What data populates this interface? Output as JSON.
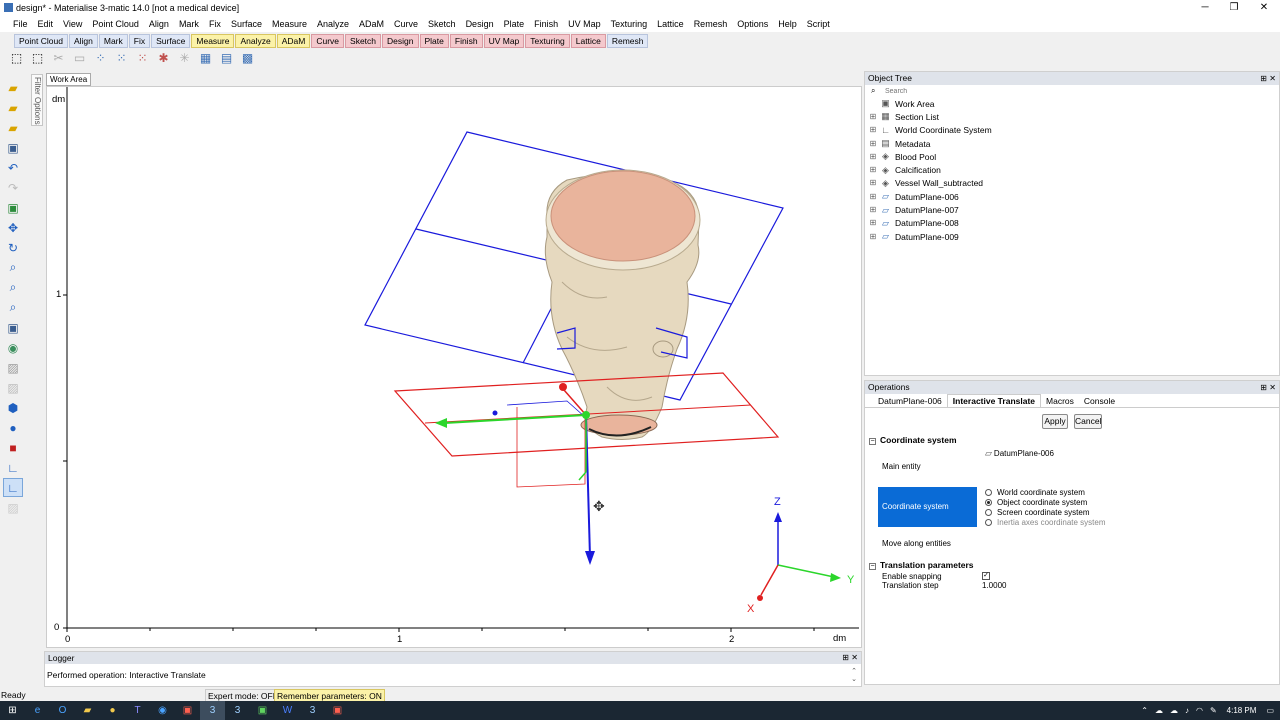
{
  "window": {
    "title": "design* - Materialise 3-matic 14.0 [not a medical device]",
    "minimize": "─",
    "maximize": "❐",
    "close": "✕"
  },
  "menu": [
    "File",
    "Edit",
    "View",
    "Point Cloud",
    "Align",
    "Mark",
    "Fix",
    "Surface",
    "Measure",
    "Analyze",
    "ADaM",
    "Curve",
    "Sketch",
    "Design",
    "Plate",
    "Finish",
    "UV Map",
    "Texturing",
    "Lattice",
    "Remesh",
    "Options",
    "Help",
    "Script"
  ],
  "mode_tabs": [
    {
      "label": "Point Cloud",
      "tone": "b"
    },
    {
      "label": "Align",
      "tone": "b"
    },
    {
      "label": "Mark",
      "tone": "b"
    },
    {
      "label": "Fix",
      "tone": "b"
    },
    {
      "label": "Surface",
      "tone": "b"
    },
    {
      "label": "Measure",
      "tone": "y"
    },
    {
      "label": "Analyze",
      "tone": "y"
    },
    {
      "label": "ADaM",
      "tone": "y"
    },
    {
      "label": "Curve",
      "tone": "p"
    },
    {
      "label": "Sketch",
      "tone": "p"
    },
    {
      "label": "Design",
      "tone": "p"
    },
    {
      "label": "Plate",
      "tone": "p"
    },
    {
      "label": "Finish",
      "tone": "p"
    },
    {
      "label": "UV Map",
      "tone": "p"
    },
    {
      "label": "Texturing",
      "tone": "p"
    },
    {
      "label": "Lattice",
      "tone": "p"
    },
    {
      "label": "Remesh",
      "tone": "b"
    }
  ],
  "toolbar_icons": [
    "select-icon",
    "deselect-icon",
    "cut-icon",
    "paste-icon",
    "mark-points-icon",
    "mark-region-icon",
    "mark-triangle-icon",
    "mark-shell-icon",
    "mark-plane-icon",
    "mark-box-icon",
    "mark-layer-icon",
    "grid-icon"
  ],
  "side_toolbar_icons": [
    "open-icon",
    "import-icon",
    "folder-icon",
    "save-icon",
    "undo-icon",
    "redo-icon",
    "view-icon",
    "pan-icon",
    "rotate-icon",
    "zoom-icon",
    "zoom-fit-icon",
    "zoom-box-icon",
    "clip-icon",
    "shade-icon",
    "wire-icon",
    "section-icon",
    "cube-icon",
    "sphere-icon",
    "render-icon",
    "axis-icon",
    "measure-icon",
    "hatch-icon"
  ],
  "filter_options": "Filter Options",
  "work_area": {
    "tab": "Work Area",
    "unit_y": "dm",
    "unit_x": "dm",
    "y_ticks": [
      "1",
      "0"
    ],
    "x_ticks": [
      "0",
      "1",
      "2"
    ],
    "axes_labels": {
      "z": "Z",
      "y": "Y",
      "x": "X"
    },
    "colors": {
      "plane_blue": "#1a1adc",
      "plane_red": "#e02020",
      "axis_green": "#2bd62b",
      "model_skin": "#e6d9bf",
      "model_top": "#e9b49c"
    }
  },
  "object_tree": {
    "title": "Object Tree",
    "search_placeholder": "Search",
    "items": [
      {
        "label": "Work Area",
        "icon": "work-area-icon",
        "indent": 0
      },
      {
        "label": "Section List",
        "icon": "section-list-icon",
        "indent": 1
      },
      {
        "label": "World Coordinate System",
        "icon": "coordinate-system-icon",
        "indent": 1
      },
      {
        "label": "Metadata",
        "icon": "metadata-icon",
        "indent": 1
      },
      {
        "label": "Blood Pool",
        "icon": "part-icon",
        "indent": 1
      },
      {
        "label": "Calcification",
        "icon": "part-icon",
        "indent": 1
      },
      {
        "label": "Vessel Wall_subtracted",
        "icon": "part-icon",
        "indent": 1
      },
      {
        "label": "DatumPlane-006",
        "icon": "datum-plane-icon",
        "indent": 1
      },
      {
        "label": "DatumPlane-007",
        "icon": "datum-plane-icon",
        "indent": 1
      },
      {
        "label": "DatumPlane-008",
        "icon": "datum-plane-icon",
        "indent": 1
      },
      {
        "label": "DatumPlane-009",
        "icon": "datum-plane-icon",
        "indent": 1
      }
    ]
  },
  "operations": {
    "title": "Operations",
    "tabs": [
      "DatumPlane-006",
      "Interactive Translate",
      "Macros",
      "Console"
    ],
    "active_tab": "Interactive Translate",
    "apply": "Apply",
    "cancel": "Cancel",
    "section_coord": "Coordinate system",
    "main_entity_label": "Main entity",
    "main_entity_value": "DatumPlane-006",
    "coord_label": "Coordinate system",
    "coord_options": [
      "World coordinate system",
      "Object coordinate system",
      "Screen coordinate system",
      "Inertia axes coordinate system"
    ],
    "coord_selected": "Object coordinate system",
    "move_along_label": "Move along entities",
    "section_translation": "Translation parameters",
    "snapping_label": "Enable snapping",
    "snapping_checked": true,
    "step_label": "Translation step",
    "step_value": "1.0000"
  },
  "logger": {
    "title": "Logger",
    "message": "Performed operation: Interactive Translate"
  },
  "status": {
    "ready": "Ready",
    "expert": "Expert mode: OFF",
    "remember": "Remember parameters: ON"
  },
  "taskbar": {
    "time": "4:18 PM"
  }
}
